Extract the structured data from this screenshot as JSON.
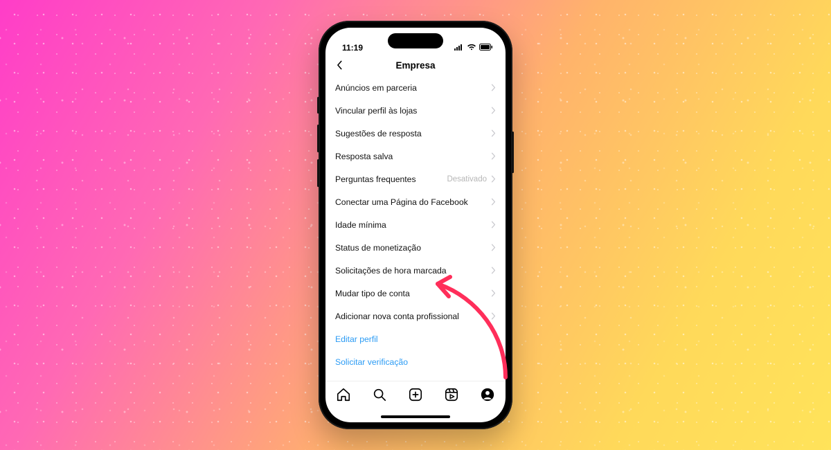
{
  "status": {
    "time": "11:19"
  },
  "header": {
    "title": "Empresa"
  },
  "menu": {
    "items": [
      {
        "label": "Anúncios em parceria",
        "status": "",
        "link": false
      },
      {
        "label": "Vincular perfil às lojas",
        "status": "",
        "link": false
      },
      {
        "label": "Sugestões de resposta",
        "status": "",
        "link": false
      },
      {
        "label": "Resposta salva",
        "status": "",
        "link": false
      },
      {
        "label": "Perguntas frequentes",
        "status": "Desativado",
        "link": false
      },
      {
        "label": "Conectar uma Página do Facebook",
        "status": "",
        "link": false
      },
      {
        "label": "Idade mínima",
        "status": "",
        "link": false
      },
      {
        "label": "Status de monetização",
        "status": "",
        "link": false
      },
      {
        "label": "Solicitações de hora marcada",
        "status": "",
        "link": false
      },
      {
        "label": "Mudar tipo de conta",
        "status": "",
        "link": false
      },
      {
        "label": "Adicionar nova conta profissional",
        "status": "",
        "link": false
      },
      {
        "label": "Editar perfil",
        "status": "",
        "link": true
      },
      {
        "label": "Solicitar verificação",
        "status": "",
        "link": true
      }
    ]
  },
  "annotation": {
    "target_item_index": 9,
    "arrow_color": "#ff2e5a"
  },
  "tabbar": {
    "items": [
      "home",
      "search",
      "create",
      "reels",
      "profile"
    ]
  }
}
